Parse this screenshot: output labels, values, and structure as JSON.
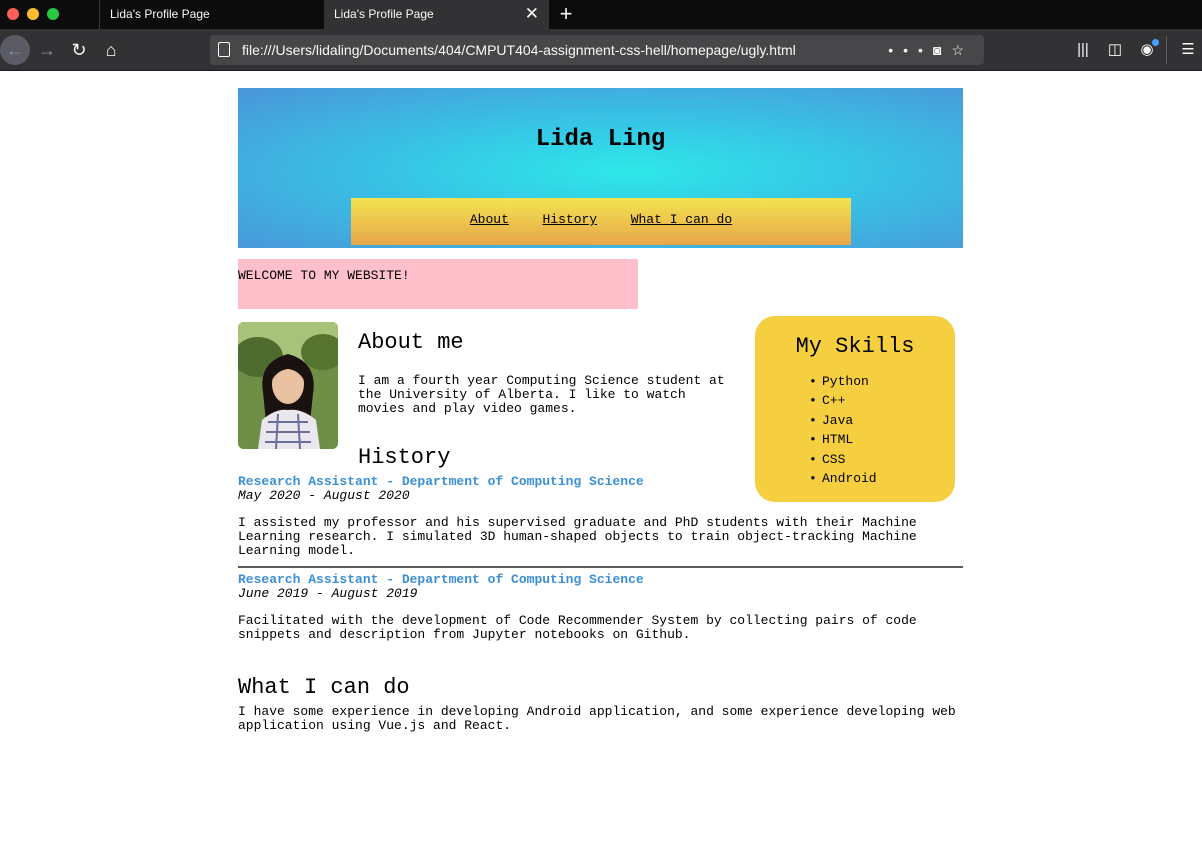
{
  "browser": {
    "tabs": [
      {
        "label": "Lida's Profile Page",
        "active": false
      },
      {
        "label": "Lida's Profile Page",
        "active": true
      }
    ],
    "url": "file:///Users/lidaling/Documents/404/CMPUT404-assignment-css-hell/homepage/ugly.html",
    "icons": [
      "back-icon",
      "forward-icon",
      "reload-icon",
      "home-icon",
      "page-icon",
      "more-icon",
      "pocket-icon",
      "star-icon",
      "library-icon",
      "sidebar-icon",
      "account-icon",
      "menu-icon"
    ]
  },
  "header": {
    "name": "Lida Ling",
    "nav": {
      "about": "About",
      "history": "History",
      "can_do": "What I can do"
    }
  },
  "welcome": "WELCOME TO MY WEBSITE!",
  "about": {
    "title": "About me",
    "text": "I am a fourth year Computing Science student at the University of Alberta. I like to watch movies and play video games."
  },
  "skills": {
    "title": "My Skills",
    "items": [
      "Python",
      "C++",
      "Java",
      "HTML",
      "CSS",
      "Android"
    ]
  },
  "history": {
    "title": "History",
    "jobs": [
      {
        "title": "Research Assistant - Department of Computing Science",
        "dates": "May 2020 - August 2020",
        "desc": "I assisted my professor and his supervised graduate and PhD students with their Machine Learning research. I simulated 3D human-shaped objects to train object-tracking Machine Learning model."
      },
      {
        "title": "Research Assistant - Department of Computing Science",
        "dates": "June 2019 - August 2019",
        "desc": "Facilitated with the development of Code Recommender System by collecting pairs of code snippets and description from Jupyter notebooks on Github."
      }
    ]
  },
  "can_do": {
    "title": "What I can do",
    "text": "I have some experience in developing Android application, and some experience developing web application using Vue.js and React."
  },
  "colors": {
    "header_center": "#2ee8e8",
    "header_edge": "#4a95d8",
    "nav_top": "#f2e350",
    "nav_bottom": "#e8a64a",
    "welcome_bg": "#ffc0cb",
    "skills_bg": "#f6cf40",
    "job_title": "#3a8fd6"
  }
}
